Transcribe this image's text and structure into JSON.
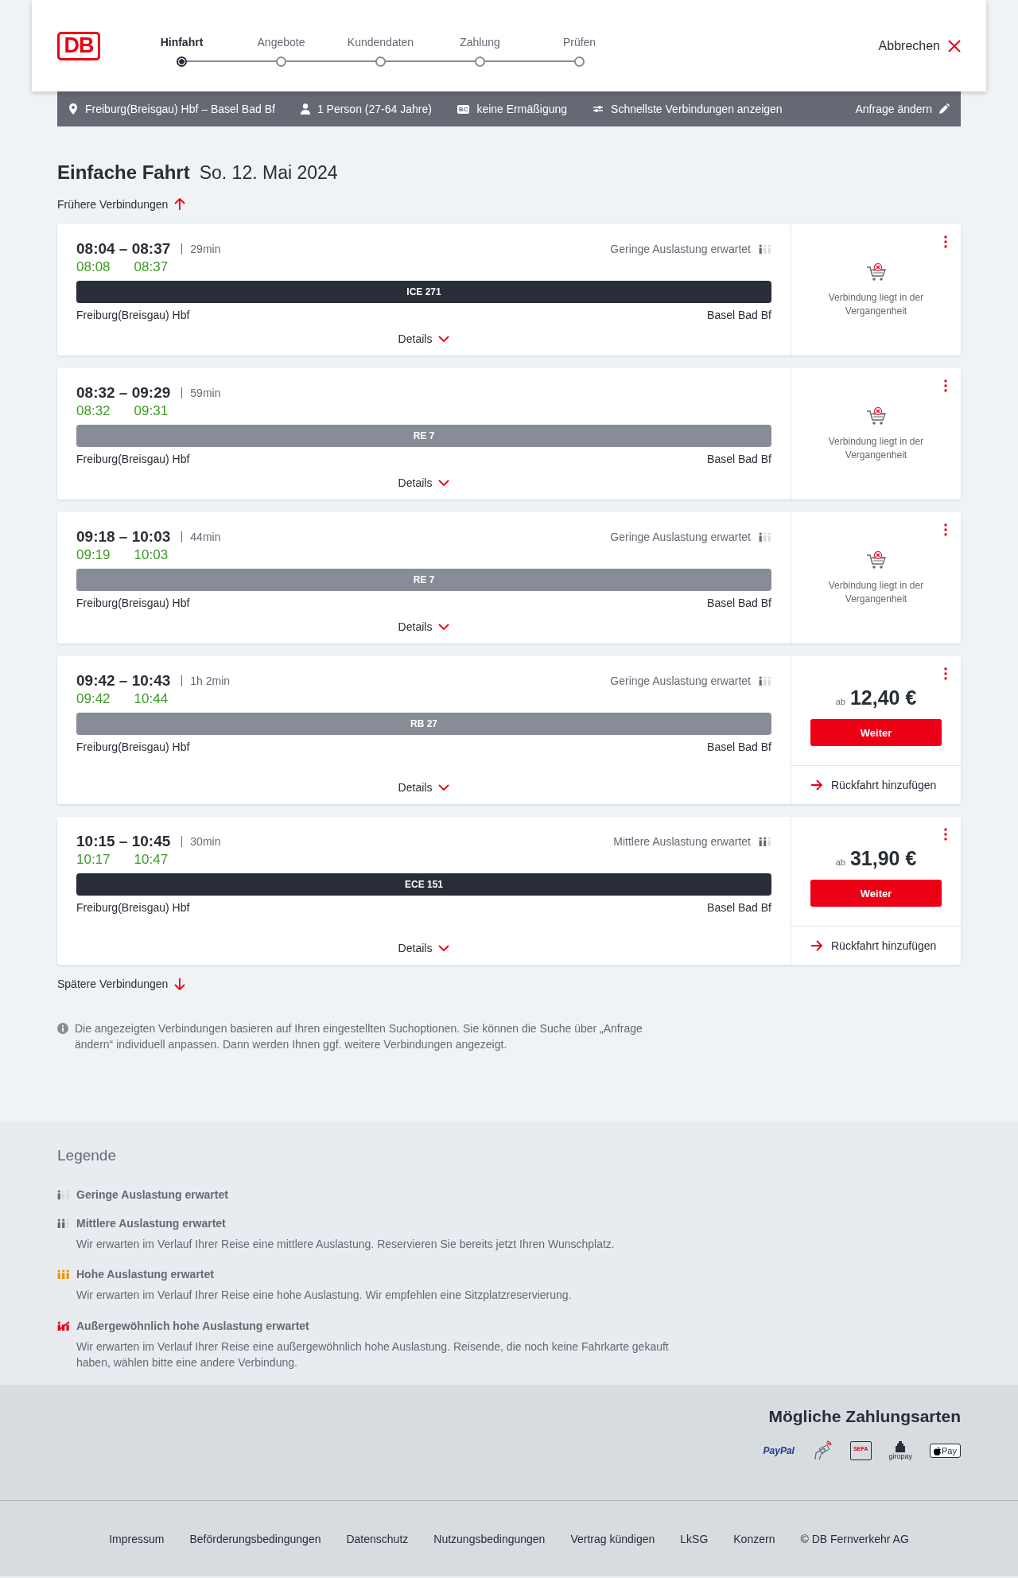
{
  "logo": {
    "text": "DB"
  },
  "steps": [
    {
      "label": "Hinfahrt",
      "selected": true
    },
    {
      "label": "Angebote",
      "selected": false
    },
    {
      "label": "Kundendaten",
      "selected": false
    },
    {
      "label": "Zahlung",
      "selected": false
    },
    {
      "label": "Prüfen",
      "selected": false
    }
  ],
  "cancel": {
    "label": "Abbrechen"
  },
  "search_bar": {
    "items": [
      {
        "kind": "route",
        "text": "Freiburg(Breisgau) Hbf – Basel Bad Bf"
      },
      {
        "kind": "person",
        "text": "1 Person (27-64 Jahre)"
      },
      {
        "kind": "card",
        "badge": "BC",
        "text": "keine Ermäßigung"
      },
      {
        "kind": "options",
        "text": "Schnellste Verbindungen anzeigen"
      }
    ],
    "edit": "Anfrage ändern"
  },
  "heading": {
    "title": "Einfache Fahrt",
    "date": "So. 12. Mai 2024"
  },
  "earlier": "Frühere Verbindungen",
  "connections": [
    {
      "time": "08:04 – 08:37",
      "duration": "29min",
      "occupancy": {
        "kind": "low",
        "text": "Geringe Auslastung erwartet"
      },
      "actual_departure": "08:08",
      "actual_arrival": "08:37",
      "train": {
        "label": "ICE 271",
        "kind": "long_distance"
      },
      "from": "Freiburg(Breisgau) Hbf",
      "to": "Basel Bad Bf",
      "details": "Details",
      "offer": {
        "kind": "past",
        "text": "Verbindung liegt in der Vergangenheit"
      }
    },
    {
      "time": "08:32 – 09:29",
      "duration": "59min",
      "actual_departure": "08:32",
      "actual_arrival": "09:31",
      "train": {
        "label": "RE 7",
        "kind": "regional"
      },
      "from": "Freiburg(Breisgau) Hbf",
      "to": "Basel Bad Bf",
      "details": "Details",
      "offer": {
        "kind": "past",
        "text": "Verbindung liegt in der Vergangenheit"
      }
    },
    {
      "time": "09:18 – 10:03",
      "duration": "44min",
      "occupancy": {
        "kind": "low",
        "text": "Geringe Auslastung erwartet"
      },
      "actual_departure": "09:19",
      "actual_arrival": "10:03",
      "train": {
        "label": "RE 7",
        "kind": "regional"
      },
      "from": "Freiburg(Breisgau) Hbf",
      "to": "Basel Bad Bf",
      "details": "Details",
      "offer": {
        "kind": "past",
        "text": "Verbindung liegt in der Vergangenheit"
      }
    },
    {
      "time": "09:42 – 10:43",
      "duration": "1h 2min",
      "occupancy": {
        "kind": "low",
        "text": "Geringe Auslastung erwartet"
      },
      "actual_departure": "09:42",
      "actual_arrival": "10:44",
      "train": {
        "label": "RB 27",
        "kind": "regional"
      },
      "from": "Freiburg(Breisgau) Hbf",
      "to": "Basel Bad Bf",
      "details": "Details",
      "offer": {
        "kind": "price",
        "prefix": "ab",
        "price": "12,40 €",
        "button": "Weiter",
        "return": "Rückfahrt hinzufügen"
      }
    },
    {
      "time": "10:15 – 10:45",
      "duration": "30min",
      "occupancy": {
        "kind": "medium",
        "text": "Mittlere Auslastung erwartet"
      },
      "actual_departure": "10:17",
      "actual_arrival": "10:47",
      "train": {
        "label": "ECE 151",
        "kind": "long_distance"
      },
      "from": "Freiburg(Breisgau) Hbf",
      "to": "Basel Bad Bf",
      "details": "Details",
      "offer": {
        "kind": "price",
        "prefix": "ab",
        "price": "31,90 €",
        "button": "Weiter",
        "return": "Rückfahrt hinzufügen"
      }
    }
  ],
  "later": "Spätere Verbindungen",
  "notice": "Die angezeigten Verbindungen basieren auf Ihren eingestellten Suchoptionen. Sie können die Suche über „Anfrage ändern“ individuell anpassen. Dann werden Ihnen ggf. weitere Verbindungen angezeigt.",
  "legend": {
    "title": "Legende",
    "items": [
      {
        "kind": "low",
        "title": "Geringe Auslastung erwartet"
      },
      {
        "kind": "medium",
        "title": "Mittlere Auslastung erwartet",
        "text": "Wir erwarten im Verlauf Ihrer Reise eine mittlere Auslastung. Reservieren Sie bereits jetzt Ihren Wunschplatz."
      },
      {
        "kind": "high",
        "title": "Hohe Auslastung erwartet",
        "text": "Wir erwarten im Verlauf Ihrer Reise eine hohe Auslastung. Wir empfehlen eine Sitzplatzreservierung."
      },
      {
        "kind": "extreme",
        "title": "Außergewöhnlich hohe Auslastung erwartet",
        "text": "Wir erwarten im Verlauf Ihrer Reise eine außergewöhnlich hohe Auslastung. Reisende, die noch keine Fahrkarte gekauft haben, wählen bitte eine andere Verbindung."
      }
    ]
  },
  "payment": {
    "title": "Mögliche Zahlungsarten",
    "methods": [
      {
        "kind": "paypal",
        "label": "PayPal"
      },
      {
        "kind": "contactless"
      },
      {
        "kind": "sepa",
        "label": "SEPA"
      },
      {
        "kind": "giropay",
        "label": "giropay"
      },
      {
        "kind": "applepay",
        "label": "Pay"
      }
    ]
  },
  "footer": [
    "Impressum",
    "Beförderungsbedingungen",
    "Datenschutz",
    "Nutzungsbedingungen",
    "Vertrag kündigen",
    "LkSG",
    "Konzern",
    "© DB Fernverkehr AG"
  ]
}
